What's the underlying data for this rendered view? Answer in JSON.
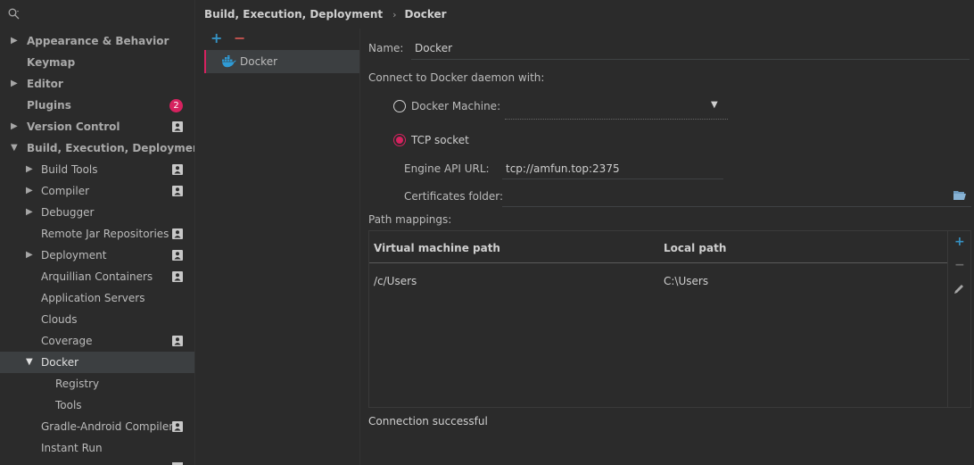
{
  "search": {
    "placeholder": ""
  },
  "sidebar": {
    "items": [
      {
        "label": "Appearance & Behavior"
      },
      {
        "label": "Keymap"
      },
      {
        "label": "Editor"
      },
      {
        "label": "Plugins",
        "badge": "2"
      },
      {
        "label": "Version Control"
      },
      {
        "label": "Build, Execution, Deployment"
      },
      {
        "label": "Build Tools"
      },
      {
        "label": "Compiler"
      },
      {
        "label": "Debugger"
      },
      {
        "label": "Remote Jar Repositories"
      },
      {
        "label": "Deployment"
      },
      {
        "label": "Arquillian Containers"
      },
      {
        "label": "Application Servers"
      },
      {
        "label": "Clouds"
      },
      {
        "label": "Coverage"
      },
      {
        "label": "Docker"
      },
      {
        "label": "Registry"
      },
      {
        "label": "Tools"
      },
      {
        "label": "Gradle-Android Compiler"
      },
      {
        "label": "Instant Run"
      }
    ]
  },
  "breadcrumb": {
    "parent": "Build, Execution, Deployment",
    "separator": "›",
    "current": "Docker"
  },
  "list": {
    "add": "+",
    "remove": "−",
    "items": [
      {
        "label": "Docker"
      }
    ]
  },
  "form": {
    "name_label": "Name:",
    "name_value": "Docker",
    "connect_label": "Connect to Docker daemon with:",
    "docker_machine_label": "Docker Machine:",
    "tcp_label": "TCP socket",
    "tcp_selected": true,
    "engine_label": "Engine API URL:",
    "engine_value": "tcp://amfun.top:2375",
    "cert_label": "Certificates folder:",
    "cert_value": "",
    "path_label": "Path mappings:",
    "status": "Connection successful"
  },
  "table": {
    "headers": [
      "Virtual machine path",
      "Local path"
    ],
    "rows": [
      [
        "/c/Users",
        "C:\\Users"
      ]
    ]
  },
  "colors": {
    "accent": "#d6225f",
    "add": "#3592c4",
    "remove": "#c75450",
    "bg": "#2b2b2b"
  }
}
